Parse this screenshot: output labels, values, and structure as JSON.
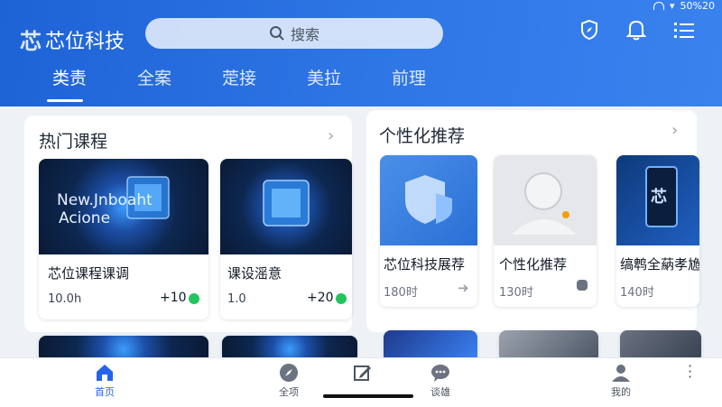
{
  "status_bar": {
    "text": "50%20"
  },
  "header": {
    "logo_mark": "芯",
    "logo_text": "芯位科技",
    "search_placeholder": "搜索",
    "tabs": [
      {
        "label": "类责"
      },
      {
        "label": "全案"
      },
      {
        "label": "萣接"
      },
      {
        "label": "美拉"
      },
      {
        "label": "前理"
      }
    ],
    "active_tab_index": 0
  },
  "hot_courses": {
    "title": "热门课程",
    "items": [
      {
        "image_text_1": "New.Jnboaht",
        "image_text_2": "Acione",
        "title": "芯位课程课调",
        "meta": "10.0h",
        "plus": "+10"
      },
      {
        "title": "课设滛意",
        "meta": "1.0",
        "plus": "+20"
      }
    ]
  },
  "recommend": {
    "title": "个性化推荐",
    "items": [
      {
        "title": "芯位科技展荐",
        "meta": "180时"
      },
      {
        "title": "个性化推荐",
        "meta": "130时"
      },
      {
        "title": "缟鹎全蒳孝尯",
        "meta": "140时",
        "image_text": "芯"
      }
    ]
  },
  "bottom_nav": [
    {
      "label": "首页",
      "icon": "home-icon"
    },
    {
      "label": "全项",
      "icon": "compass-icon"
    },
    {
      "label": "",
      "icon": "edit-icon"
    },
    {
      "label": "谈雄",
      "icon": "chat-icon"
    },
    {
      "label": "我的",
      "icon": "user-icon"
    }
  ],
  "colors": {
    "brand": "#2563eb",
    "header": "#2a6fe0",
    "accent_green": "#22c55e"
  }
}
